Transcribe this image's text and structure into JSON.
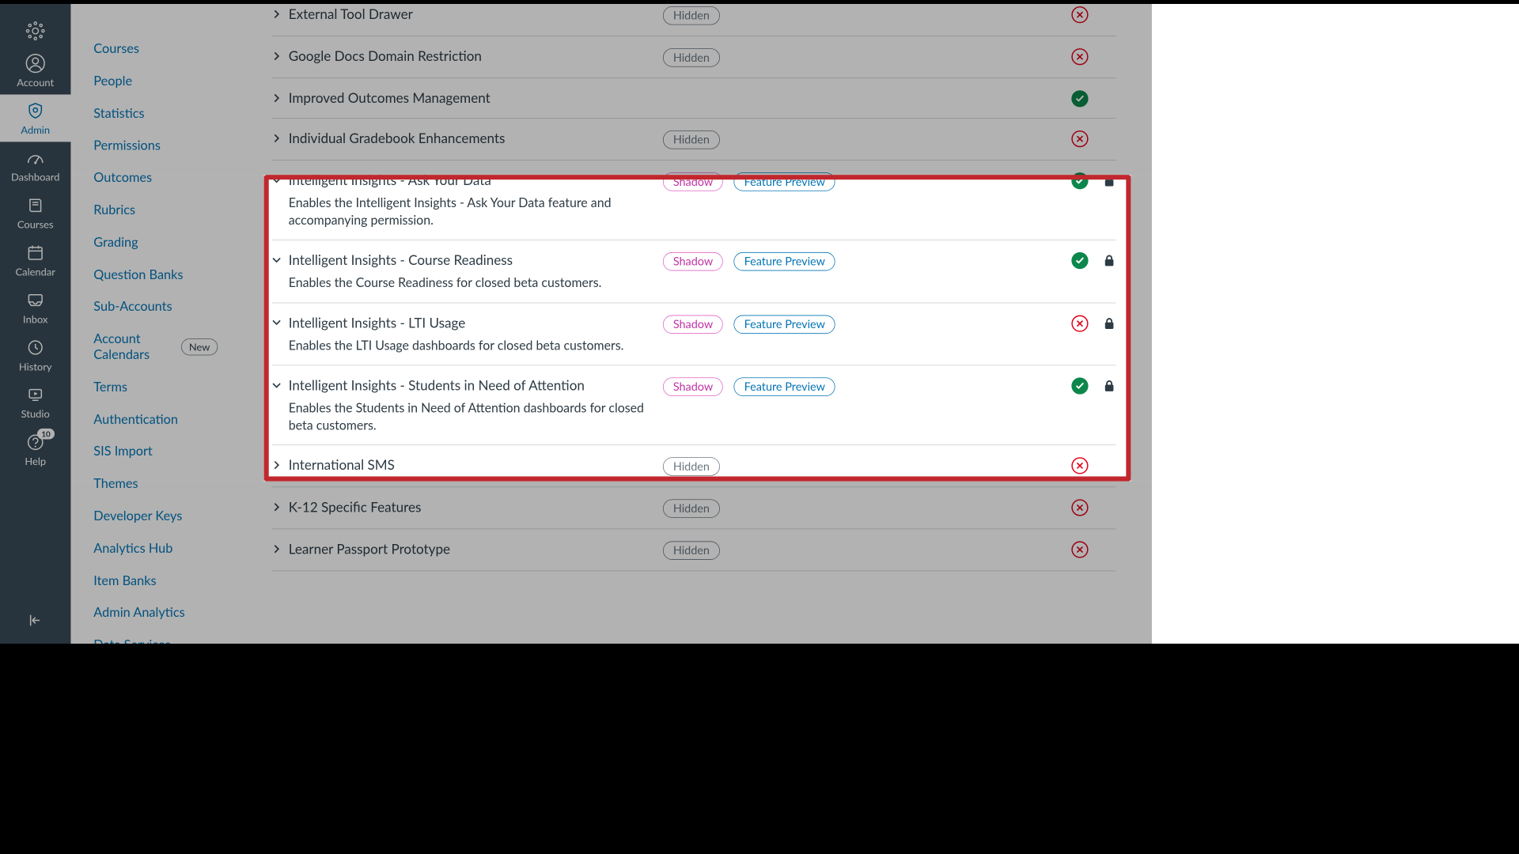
{
  "global_nav": {
    "items": [
      {
        "id": "logo",
        "label": ""
      },
      {
        "id": "account",
        "label": "Account"
      },
      {
        "id": "admin",
        "label": "Admin"
      },
      {
        "id": "dashboard",
        "label": "Dashboard"
      },
      {
        "id": "courses",
        "label": "Courses"
      },
      {
        "id": "calendar",
        "label": "Calendar"
      },
      {
        "id": "inbox",
        "label": "Inbox"
      },
      {
        "id": "history",
        "label": "History"
      },
      {
        "id": "studio",
        "label": "Studio"
      },
      {
        "id": "help",
        "label": "Help",
        "badge": "10"
      }
    ]
  },
  "context_nav": {
    "items": [
      {
        "label": "Courses"
      },
      {
        "label": "People"
      },
      {
        "label": "Statistics"
      },
      {
        "label": "Permissions"
      },
      {
        "label": "Outcomes"
      },
      {
        "label": "Rubrics"
      },
      {
        "label": "Grading"
      },
      {
        "label": "Question Banks"
      },
      {
        "label": "Sub-Accounts"
      },
      {
        "label": "Account Calendars",
        "badge": "New"
      },
      {
        "label": "Terms"
      },
      {
        "label": "Authentication"
      },
      {
        "label": "SIS Import"
      },
      {
        "label": "Themes"
      },
      {
        "label": "Developer Keys"
      },
      {
        "label": "Analytics Hub"
      },
      {
        "label": "Item Banks"
      },
      {
        "label": "Admin Analytics"
      },
      {
        "label": "Data Services"
      }
    ]
  },
  "tag_labels": {
    "hidden": "Hidden",
    "shadow": "Shadow",
    "preview": "Feature Preview"
  },
  "features": [
    {
      "title": "External Tool Drawer",
      "expanded": false,
      "tags": [
        "hidden"
      ],
      "status": "disabled",
      "locked": false
    },
    {
      "title": "Google Docs Domain Restriction",
      "expanded": false,
      "tags": [
        "hidden"
      ],
      "status": "disabled",
      "locked": false
    },
    {
      "title": "Improved Outcomes Management",
      "expanded": false,
      "tags": [],
      "status": "enabled",
      "locked": false
    },
    {
      "title": "Individual Gradebook Enhancements",
      "expanded": false,
      "tags": [
        "hidden"
      ],
      "status": "disabled",
      "locked": false
    },
    {
      "title": "Intelligent Insights - Ask Your Data",
      "expanded": true,
      "desc": "Enables the Intelligent Insights - Ask Your Data feature and accompanying permission.",
      "tags": [
        "shadow",
        "preview"
      ],
      "status": "enabled",
      "locked": true
    },
    {
      "title": "Intelligent Insights - Course Readiness",
      "expanded": true,
      "desc": "Enables the Course Readiness for closed beta customers.",
      "tags": [
        "shadow",
        "preview"
      ],
      "status": "enabled",
      "locked": true
    },
    {
      "title": "Intelligent Insights - LTI Usage",
      "expanded": true,
      "desc": "Enables the LTI Usage dashboards for closed beta customers.",
      "tags": [
        "shadow",
        "preview"
      ],
      "status": "disabled",
      "locked": true
    },
    {
      "title": "Intelligent Insights - Students in Need of Attention",
      "expanded": true,
      "desc": "Enables the Students in Need of Attention dashboards for closed beta customers.",
      "tags": [
        "shadow",
        "preview"
      ],
      "status": "enabled",
      "locked": true
    },
    {
      "title": "International SMS",
      "expanded": false,
      "tags": [
        "hidden"
      ],
      "status": "disabled",
      "locked": false
    },
    {
      "title": "K-12 Specific Features",
      "expanded": false,
      "tags": [
        "hidden"
      ],
      "status": "disabled",
      "locked": false
    },
    {
      "title": "Learner Passport Prototype",
      "expanded": false,
      "tags": [
        "hidden"
      ],
      "status": "disabled",
      "locked": false
    }
  ]
}
